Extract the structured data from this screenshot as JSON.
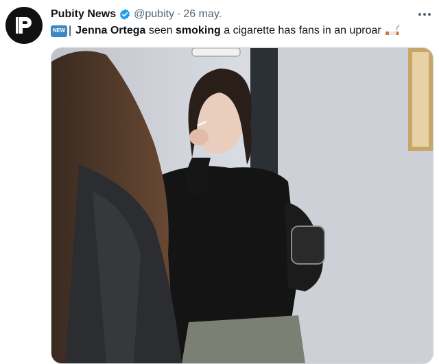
{
  "account": {
    "name": "Pubity News",
    "handle": "@pubity",
    "separator": "·",
    "date": "26 may.",
    "verified_color": "#1d9bf0"
  },
  "tweet": {
    "badge": "NEW",
    "divider": "|",
    "parts": [
      "Jenna Ortega",
      " seen ",
      "smoking",
      " a cigarette has fans in an uproar"
    ],
    "emoji": "cigarette-emoji"
  },
  "icons": {
    "avatar": "pubity-logo",
    "verified": "verified-badge-icon",
    "more": "more-options-icon"
  },
  "media": {
    "kind": "video-still",
    "description_colors": [
      "#c9ccd2",
      "#141414",
      "#2a1f18",
      "#7c7f74"
    ]
  }
}
